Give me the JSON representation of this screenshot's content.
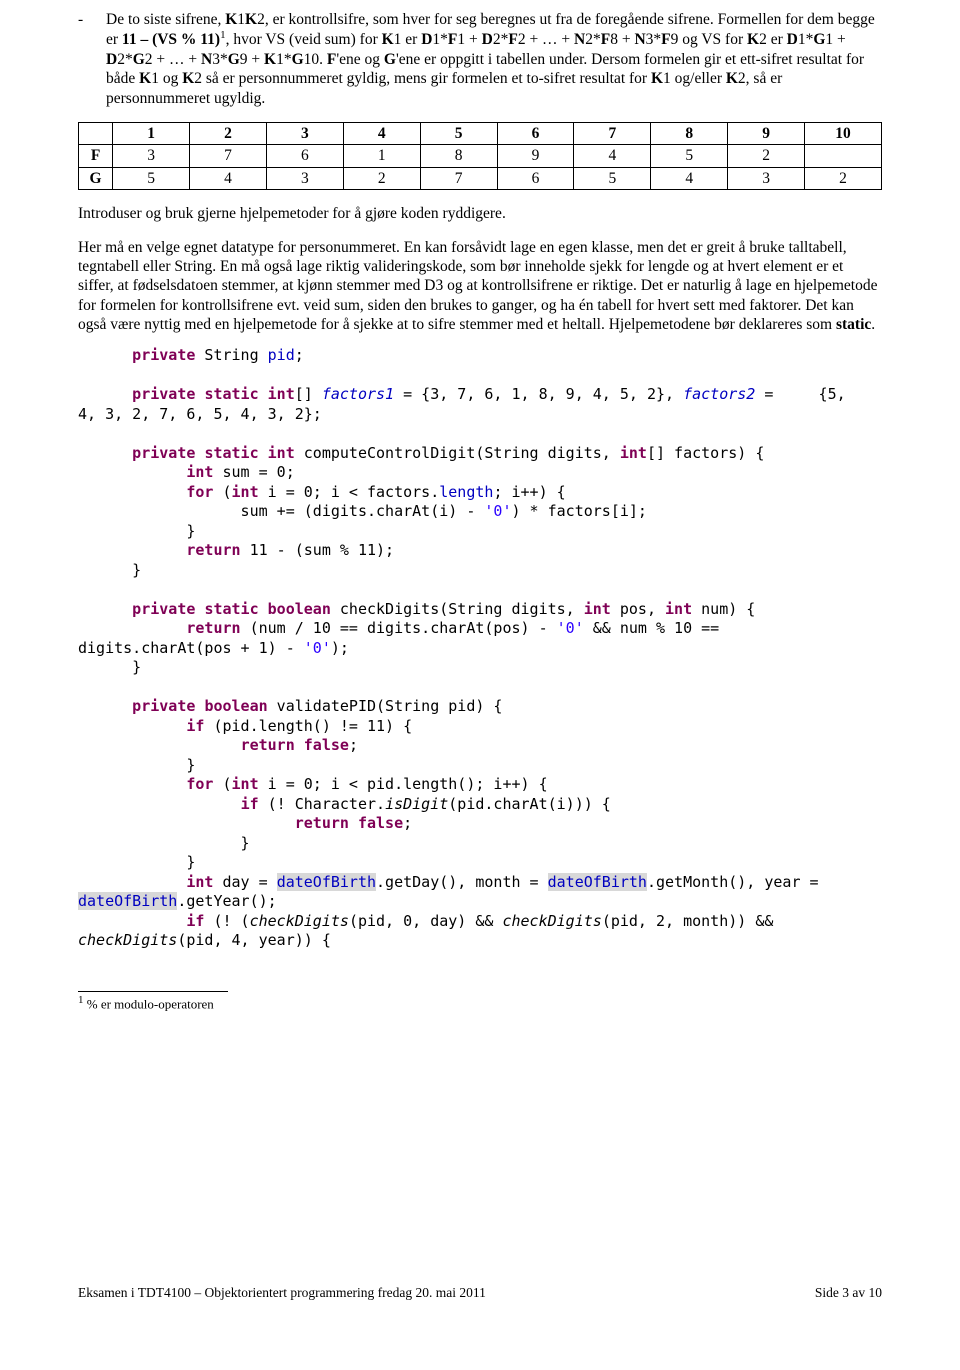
{
  "bullet": {
    "dash": "-",
    "text": "De to siste sifrene, K1K2, er kontrollsifre, som hver for seg beregnes ut fra de foregående sifrene. Formellen for dem begge er 11 – (VS % 11)¹, hvor VS (veid sum) for K1 er D1*F1 + D2*F2 + … + N2*F8 + N3*F9 og VS for K2 er D1*G1 + D2*G2 + … + N3*G9 + K1*G10. F'ene og G'ene er oppgitt i tabellen under. Dersom formelen gir et ett-sifret resultat for både K1 og K2 så er personnummeret gyldig, mens gir formelen et to-sifret resultat for K1 og/eller K2, så er personnummeret ugyldig."
  },
  "table": {
    "header_row": [
      "",
      "1",
      "2",
      "3",
      "4",
      "5",
      "6",
      "7",
      "8",
      "9",
      "10"
    ],
    "f_label": "F",
    "f_row": [
      "3",
      "7",
      "6",
      "1",
      "8",
      "9",
      "4",
      "5",
      "2",
      ""
    ],
    "g_label": "G",
    "g_row": [
      "5",
      "4",
      "3",
      "2",
      "7",
      "6",
      "5",
      "4",
      "3",
      "2"
    ]
  },
  "intro_para": "Introduser og bruk gjerne hjelpemetoder for å gjøre koden ryddigere.",
  "solution_para": "Her må en velge egnet datatype for personummeret. En kan forsåvidt lage en egen klasse, men det er greit å bruke talltabell, tegntabell eller String. En må også lage riktig valideringskode, som bør inneholde sjekk for lengde og at hvert element er et siffer, at fødselsdatoen stemmer, at kjønn stemmer med D3 og at kontrollsifrene er riktige. Det er naturlig å lage en hjelpemetode for formelen for kontrollsifrene evt. veid sum, siden den brukes to ganger, og ha én tabell for hvert sett med faktorer. Det kan også være nyttig med en hjelpemetode for å sjekke at to sifre stemmer med et heltall. Hjelpemetodene bør deklareres som ",
  "solution_static": "static",
  "solution_dot": ".",
  "code": {
    "line01": "      private String pid;",
    "line02": "",
    "line03a": "      private static int[] ",
    "line03b": "factors1",
    "line03c": " = {3, 7, 6, 1, 8, 9, 4, 5, 2}, ",
    "line03d": "factors2",
    "line03e": " =     {5,",
    "line04": "4, 3, 2, 7, 6, 5, 4, 3, 2};",
    "line05": "",
    "line06": "      private static int computeControlDigit(String digits, int[] factors) {",
    "line07": "            int sum = 0;",
    "line08": "            for (int i = 0; i < factors.length; i++) {",
    "line09": "                  sum += (digits.charAt(i) - '0') * factors[i];",
    "line10": "            }",
    "line11": "            return 11 - (sum % 11);",
    "line12": "      }",
    "line13": "",
    "line14": "      private static boolean checkDigits(String digits, int pos, int num) {",
    "line15a": "            return (num / 10 == digits.charAt(pos) - ",
    "line15b": "'0'",
    "line15c": " && num % 10 ==",
    "line16a": "digits.charAt(pos + 1) - ",
    "line16b": "'0'",
    "line16c": ");",
    "line17": "      }",
    "line18": "",
    "line19": "      private boolean validatePID(String pid) {",
    "line20": "            if (pid.length() != 11) {",
    "line21": "                  return false;",
    "line22": "            }",
    "line23": "            for (int i = 0; i < pid.length(); i++) {",
    "line24": "                  if (! Character.isDigit(pid.charAt(i))) {",
    "line25": "                        return false;",
    "line26": "                  }",
    "line27": "            }",
    "line28a": "            int day = ",
    "line28b": "dateOfBirth",
    "line28c": ".getDay(), month = ",
    "line28d": "dateOfBirth",
    "line28e": ".getMonth(), year =",
    "line29a": "dateOfBirth",
    "line29b": ".getYear();",
    "line30a": "            if (! (",
    "line30b": "checkDigits",
    "line30c": "(pid, 0, day) && ",
    "line30d": "checkDigits",
    "line30e": "(pid, 2, month)) &&",
    "line31a": "checkDigits",
    "line31b": "(pid, 4, year)) {"
  },
  "footnote_marker": "1",
  "footnote_text": " % er modulo-operatoren",
  "footer_left": "Eksamen i TDT4100 – Objektorientert programmering fredag 20. mai 2011",
  "footer_right": "Side 3 av 10"
}
